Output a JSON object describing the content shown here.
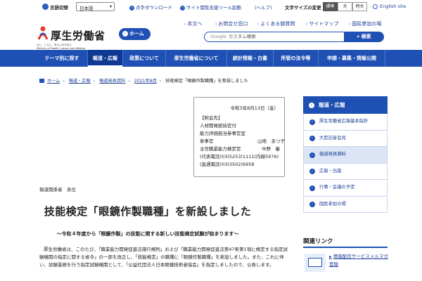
{
  "utility": {
    "lang_label": "言語切替",
    "lang_value": "日本語",
    "links": [
      {
        "label": "点字ダウンロード"
      },
      {
        "label": "サイト閲覧支援ツール起動"
      },
      {
        "label": "(ヘルプ)"
      }
    ],
    "font_size_label": "文字サイズの変更",
    "font_sizes": [
      {
        "label": "標準",
        "active": true
      },
      {
        "label": "大",
        "active": false
      },
      {
        "label": "特大",
        "active": false
      }
    ],
    "english": "English site"
  },
  "header": {
    "logo_name": "厚生労働省",
    "logo_tagline": "ひと、くらし、みらいのために",
    "logo_english": "Ministry of Health, Labour and Welfare",
    "home_label": "ホーム",
    "links": [
      {
        "label": "本文へ"
      },
      {
        "label": "お問合せ窓口"
      },
      {
        "label": "よくある御質問"
      },
      {
        "label": "サイトマップ"
      },
      {
        "label": "国民参加の場"
      }
    ],
    "search_brand": "Google",
    "search_placeholder": "カスタム検索",
    "search_button": "検索"
  },
  "nav": [
    {
      "label": "テーマ別に探す",
      "active": false
    },
    {
      "label": "報道・広報",
      "active": true
    },
    {
      "label": "政策について",
      "active": false
    },
    {
      "label": "厚生労働省について",
      "active": false
    },
    {
      "label": "統計情報・白書",
      "active": false
    },
    {
      "label": "所管の法令等",
      "active": false
    },
    {
      "label": "申請・募集・情報公開",
      "active": false
    }
  ],
  "breadcrumb": [
    {
      "label": "ホーム",
      "link": true
    },
    {
      "label": "報道・広報",
      "link": true
    },
    {
      "label": "報道発表資料",
      "link": true
    },
    {
      "label": "2021年8月",
      "link": true
    },
    {
      "label": "技能検定「眼鏡作製職種」を新設しました",
      "link": false
    }
  ],
  "release": {
    "date": "令和3年8月13日（金）",
    "contact_heading": "【照会先】",
    "lines": [
      {
        "a": "人材開発統括官付",
        "b": ""
      },
      {
        "a": "能力評価担当参事官室",
        "b": ""
      },
      {
        "a": "参事官",
        "b": "山地　あつ子"
      },
      {
        "a": "主任職業能力検定官",
        "b": "中野　審"
      },
      {
        "a": "(代表電話)03(5253)1111(内線5976)",
        "b": ""
      },
      {
        "a": "(直通電話)03(3502)6958",
        "b": ""
      }
    ]
  },
  "addressee": "報道関係者　各位",
  "title": "技能検定「眼鏡作製職種」を新設しました",
  "subtitle": "～令和４年度から「眼鏡作製」の技能に関する新しい技能検定試験が始まります～",
  "body": "厚生労働省は、このたび、「職業能力開発促進法施行規則」および「職業能力開発促進法第47条第1項に規定する指定試験機関の指定に関する省令」の一部を改正し、「技能検定」の職種に「眼鏡作製職種」を新設しました。また、これに伴い、試験業務を行う指定試験機関として、「公益社団法人日本眼鏡技術者協会」を指定しましたので、公表します。",
  "sidebar": {
    "heading": "報道・広報",
    "items": [
      {
        "label": "厚生労働省広報基本指針",
        "active": false
      },
      {
        "label": "大臣記者会見",
        "active": false
      },
      {
        "label": "報道発表資料",
        "active": true
      },
      {
        "label": "広報・出版",
        "active": false
      },
      {
        "label": "行事・会議の予定",
        "active": false
      },
      {
        "label": "国民参加の場",
        "active": false
      }
    ]
  },
  "related": {
    "heading": "関連リンク",
    "items": [
      {
        "label": "情報配信サービスメルマガ登録"
      }
    ]
  },
  "colors": {
    "brand_blue": "#1f50b4",
    "active_nav": "#0d3893",
    "sidebar_active": "#dbe5f6"
  }
}
